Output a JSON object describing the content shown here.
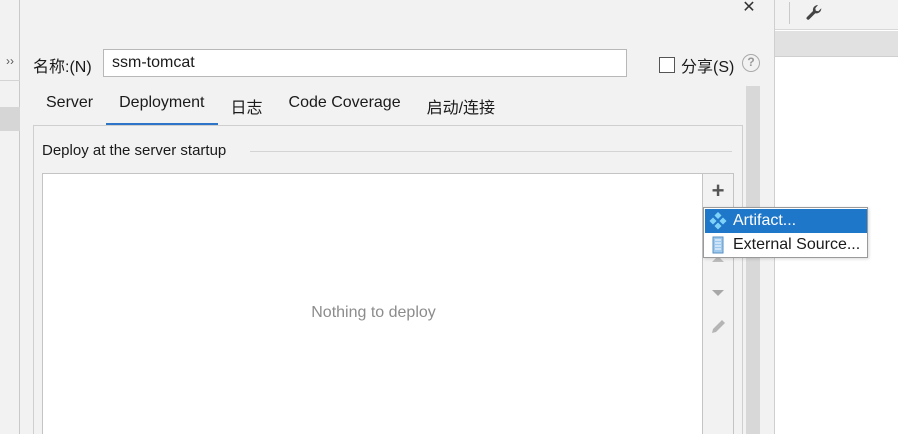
{
  "dialog": {
    "close_glyph": "✕",
    "name_label": "名称:(N)",
    "name_value": "ssm-tomcat",
    "share_label": "分享(S)",
    "help_glyph": "?"
  },
  "tabs": [
    {
      "label": "Server",
      "active": false
    },
    {
      "label": "Deployment",
      "active": true
    },
    {
      "label": "日志",
      "active": false
    },
    {
      "label": "Code Coverage",
      "active": false
    },
    {
      "label": "启动/连接",
      "active": false
    }
  ],
  "deployment": {
    "section_title": "Deploy at the server startup",
    "empty_text": "Nothing to deploy",
    "add_glyph": "+"
  },
  "popup": {
    "items": [
      {
        "label": "Artifact...",
        "icon": "artifact-icon",
        "selected": true
      },
      {
        "label": "External Source...",
        "icon": "external-source-icon",
        "selected": false
      }
    ]
  },
  "left_strip": {
    "chevron": "››"
  },
  "colors": {
    "accent": "#2f75c7",
    "popup_selected": "#1f77c9",
    "empty_text": "#8c8c8c"
  }
}
